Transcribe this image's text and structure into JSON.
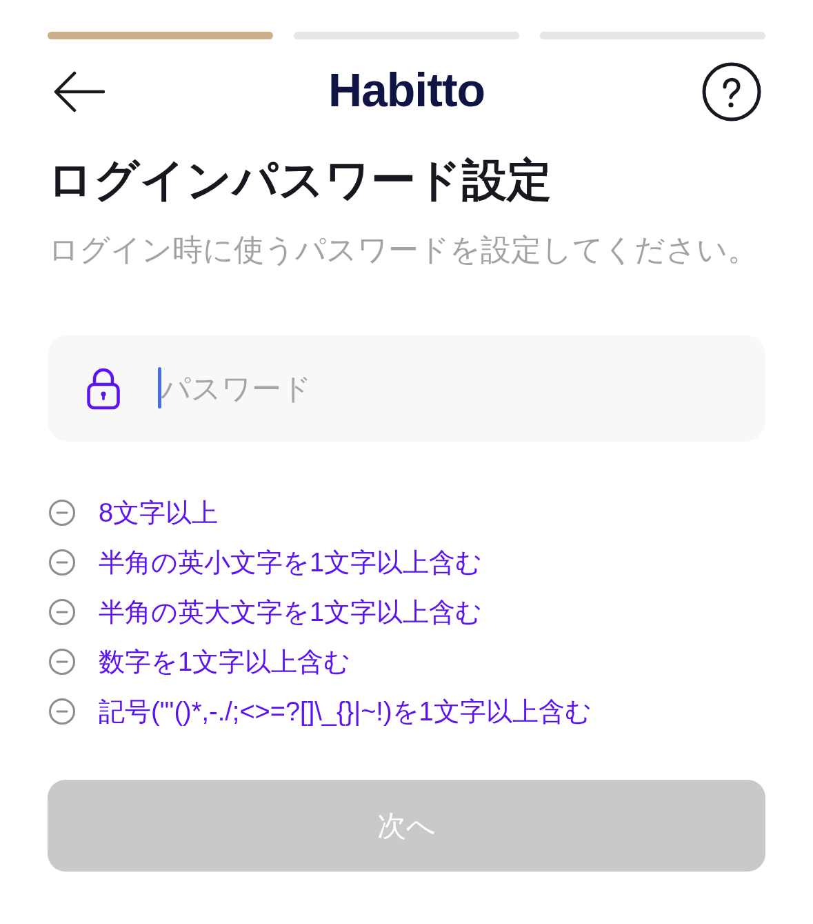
{
  "progress": [
    {
      "done": true
    },
    {
      "done": false
    },
    {
      "done": false
    }
  ],
  "header": {
    "logo": "Habitto"
  },
  "title": "ログインパスワード設定",
  "subtitle": "ログイン時に使うパスワードを設定してください。",
  "password_field": {
    "placeholder": "パスワード",
    "focused": true
  },
  "requirements": [
    {
      "text": "8文字以上",
      "met": false
    },
    {
      "text": "半角の英小文字を1文字以上含む",
      "met": false
    },
    {
      "text": "半角の英大文字を1文字以上含む",
      "met": false
    },
    {
      "text": "数字を1文字以上含む",
      "met": false
    },
    {
      "text": "記号(\"'()*,-./;<>=?[]\\_{}|~!)を1文字以上含む",
      "met": false
    }
  ],
  "next_button": {
    "label": "次へ",
    "disabled": true
  }
}
